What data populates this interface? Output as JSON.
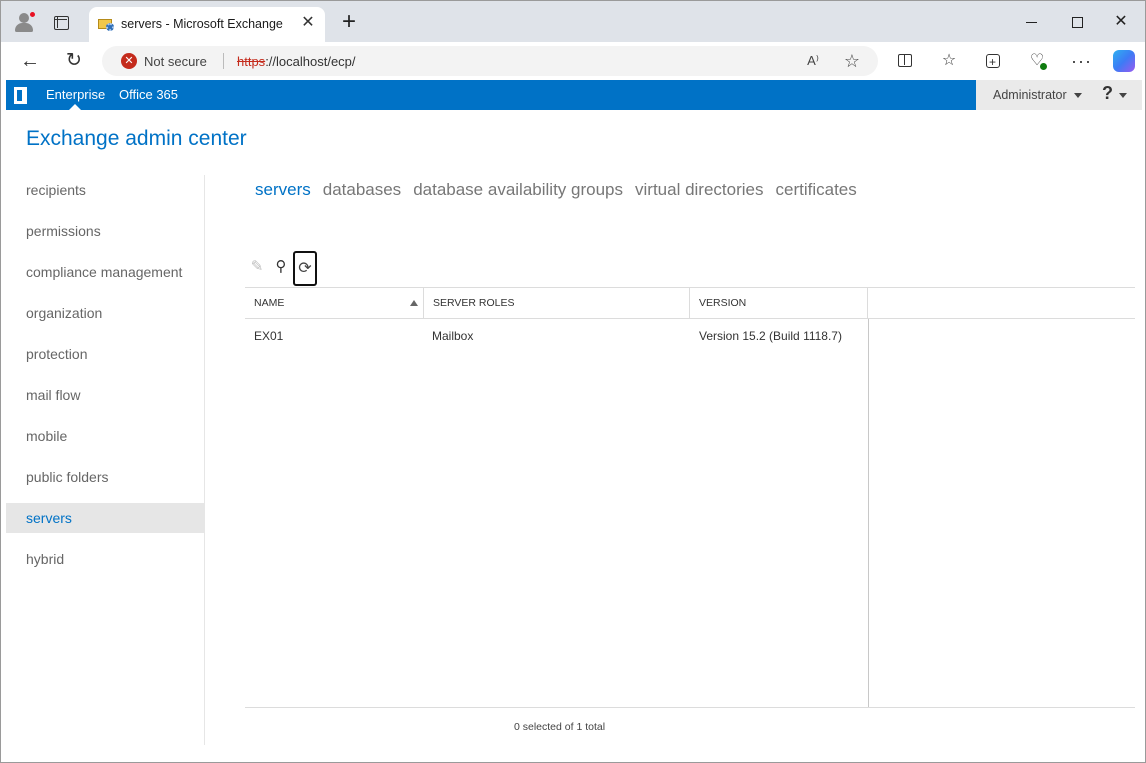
{
  "browser": {
    "tab_title": "servers - Microsoft Exchange",
    "security_text": "Not secure",
    "url_protocol": "https",
    "url_rest": "://localhost/ecp/",
    "read_aloud_label": "A⁾",
    "icons": {
      "profile": "profile-icon",
      "tab_actions": "tab-actions-icon",
      "favicon": "exchange-favicon",
      "back": "back-arrow-icon",
      "reload": "reload-icon",
      "security": "not-secure-icon",
      "favorite": "star-icon",
      "split": "split-screen-icon",
      "favorites": "favorites-icon",
      "collections": "collections-icon",
      "health": "browser-essentials-icon",
      "more": "more-icon",
      "copilot": "copilot-icon"
    }
  },
  "suitebar": {
    "enterprise": "Enterprise",
    "office365": "Office 365",
    "user": "Administrator",
    "help": "?"
  },
  "eac": {
    "title": "Exchange admin center"
  },
  "nav": {
    "items": [
      {
        "label": "recipients"
      },
      {
        "label": "permissions"
      },
      {
        "label": "compliance management"
      },
      {
        "label": "organization"
      },
      {
        "label": "protection"
      },
      {
        "label": "mail flow"
      },
      {
        "label": "mobile"
      },
      {
        "label": "public folders"
      },
      {
        "label": "servers",
        "selected": true
      },
      {
        "label": "hybrid"
      }
    ]
  },
  "subtabs": [
    {
      "label": "servers",
      "active": true
    },
    {
      "label": "databases"
    },
    {
      "label": "database availability groups"
    },
    {
      "label": "virtual directories"
    },
    {
      "label": "certificates"
    }
  ],
  "grid": {
    "columns": [
      "NAME",
      "SERVER ROLES",
      "VERSION"
    ],
    "rows": [
      {
        "name": "EX01",
        "roles": "Mailbox",
        "version": "Version 15.2 (Build 1118.7)"
      }
    ],
    "status": "0 selected of 1 total"
  },
  "colors": {
    "accent": "#0072c6",
    "insecure": "#c42b1c"
  }
}
